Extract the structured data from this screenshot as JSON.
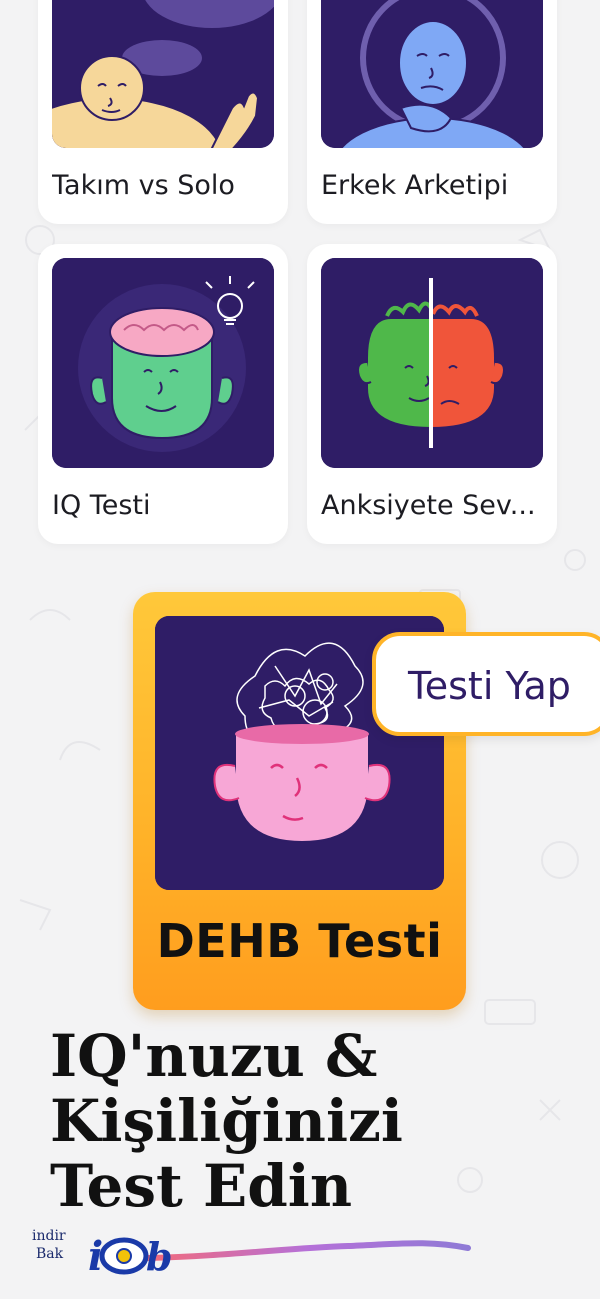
{
  "cards": [
    {
      "label": "Takım vs Solo",
      "icon": "thinking-person-icon"
    },
    {
      "label": "Erkek Arketipi",
      "icon": "pondering-man-icon"
    },
    {
      "label": "IQ Testi",
      "icon": "brain-head-icon"
    },
    {
      "label": "Anksiyete Sev...",
      "icon": "split-face-icon"
    }
  ],
  "featured": {
    "title": "DEHB Testi",
    "cta_label": "Testi Yap",
    "icon": "tangled-mind-icon",
    "colors": {
      "card_gradient_top": "#ffc83a",
      "card_gradient_bottom": "#ff9d1e",
      "thumb_bg": "#2f1d66",
      "cta_text": "#2f1d66"
    }
  },
  "headline": {
    "line1": "IQ'nuzu &",
    "line2": "Kişiliğinizi",
    "line3": "Test Edin"
  },
  "watermark": {
    "word1": "indir",
    "word2": "Bak",
    "logo": "iob-eye-logo-icon"
  }
}
